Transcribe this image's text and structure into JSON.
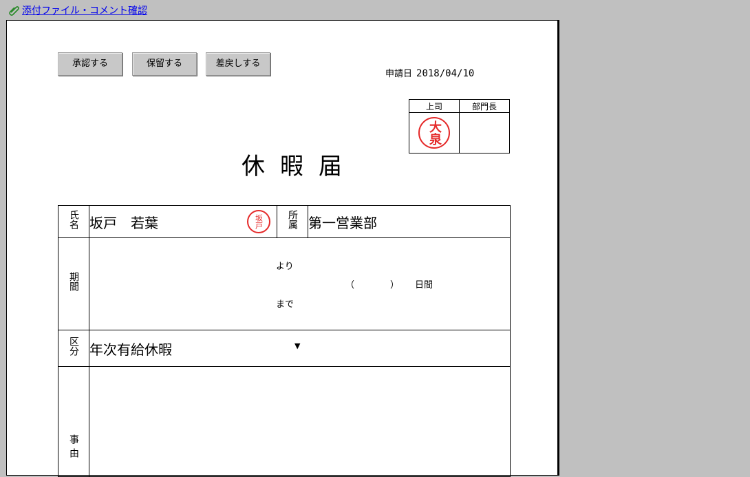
{
  "header": {
    "link_label": "添付ファイル・コメント確認",
    "link_icon": "paperclip-icon"
  },
  "buttons": {
    "approve": "承認する",
    "hold": "保留する",
    "return": "差戻しする"
  },
  "application_date": {
    "label": "申請日",
    "value": "2018/04/10"
  },
  "approvals": {
    "col1": "上司",
    "col2": "部門長",
    "col1_seal": "大泉",
    "seal_color": "#e52a2a"
  },
  "title": "休暇届",
  "form": {
    "name_label": "氏名",
    "name_value": "坂戸　若葉",
    "name_seal": "坂戸",
    "dept_label": "所属",
    "dept_value": "第一営業部",
    "period_label": "期間",
    "from_text": "より",
    "to_text": "まで",
    "open_paren": "（",
    "close_paren": "）",
    "days_text": "日間",
    "type_label": "区分",
    "type_value": "年次有給休暇",
    "reason_label": "事由"
  }
}
